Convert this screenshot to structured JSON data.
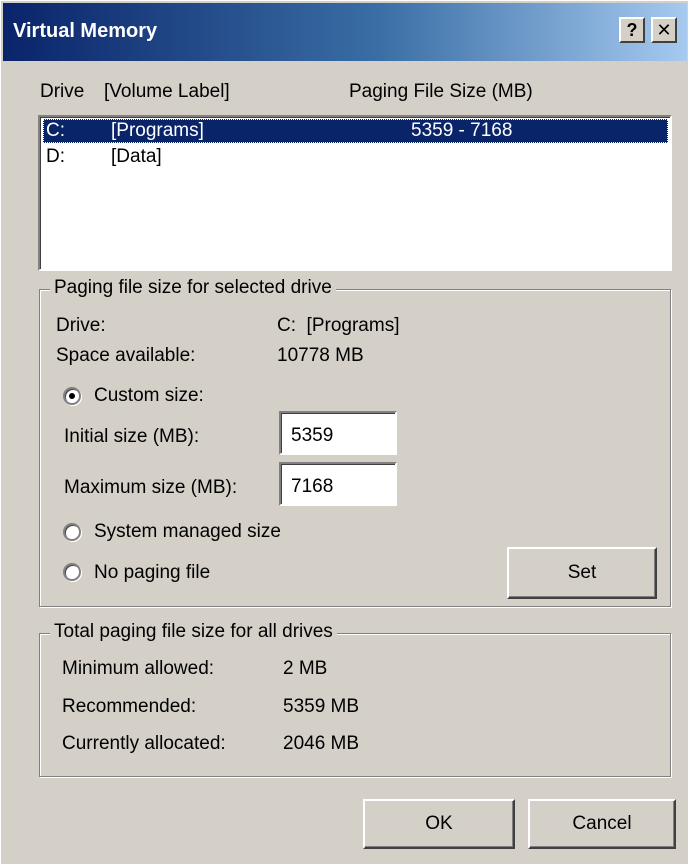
{
  "window": {
    "title": "Virtual Memory",
    "help_label": "?",
    "close_label": "✕"
  },
  "drive_list": {
    "header_drive": "Drive",
    "header_volume": "[Volume Label]",
    "header_size": "Paging File Size (MB)",
    "rows": [
      {
        "drive": "C:",
        "label": "[Programs]",
        "size": "5359 - 7168",
        "selected": true
      },
      {
        "drive": "D:",
        "label": "[Data]",
        "size": "",
        "selected": false
      }
    ]
  },
  "selected_drive_group": {
    "title": "Paging file size for selected drive",
    "drive_label": "Drive:",
    "drive_value": "C:  [Programs]",
    "space_label": "Space available:",
    "space_value": "10778 MB",
    "custom_size_label": "Custom size:",
    "initial_label": "Initial size (MB):",
    "initial_value": "5359",
    "maximum_label": "Maximum size (MB):",
    "maximum_value": "7168",
    "system_managed_label": "System managed size",
    "no_paging_label": "No paging file",
    "selected_option": "custom",
    "set_button": "Set"
  },
  "total_group": {
    "title": "Total paging file size for all drives",
    "min_label": "Minimum allowed:",
    "min_value": "2 MB",
    "recommended_label": "Recommended:",
    "recommended_value": "5359 MB",
    "allocated_label": "Currently allocated:",
    "allocated_value": "2046 MB"
  },
  "footer": {
    "ok_button": "OK",
    "cancel_button": "Cancel"
  },
  "colors": {
    "face": "#d4d0c8",
    "title_start": "#0a246a",
    "title_end": "#a6caf0",
    "selection": "#0a246a"
  }
}
